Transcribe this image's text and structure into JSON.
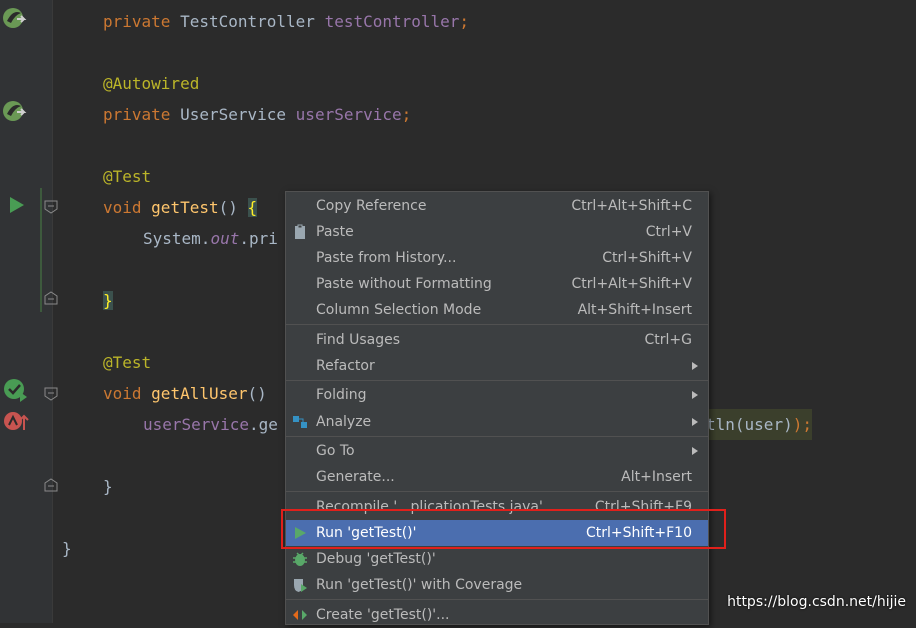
{
  "editor": {
    "line1": {
      "kw": "private",
      "type": " TestController ",
      "field": "testController",
      "end": ";"
    },
    "line3": {
      "ann": "@Autowired"
    },
    "line4": {
      "kw": "private",
      "type": " UserService ",
      "field": "userService",
      "end": ";"
    },
    "line6": {
      "ann": "@Test"
    },
    "line7": {
      "kw": "void",
      "name": "getTest",
      "paren": "() ",
      "brace": "{"
    },
    "line8": {
      "pre": "System.",
      "out": "out",
      "post": ".pri"
    },
    "line10": {
      "brace": "}"
    },
    "line12": {
      "ann": "@Test"
    },
    "line13": {
      "kw": "void",
      "name": "getAllUser",
      "paren": "()"
    },
    "line14": {
      "field": "userService",
      "post": ".ge",
      "tail_call": "tln",
      "tail_arg": "(user)",
      "tail_end": ");"
    },
    "line16": {
      "brace": "}"
    },
    "line18": {
      "brace": "}"
    }
  },
  "context_menu": {
    "items": [
      {
        "label": "Copy Reference",
        "shortcut": "Ctrl+Alt+Shift+C"
      },
      {
        "label": "Paste",
        "shortcut": "Ctrl+V"
      },
      {
        "label": "Paste from History...",
        "shortcut": "Ctrl+Shift+V"
      },
      {
        "label": "Paste without Formatting",
        "shortcut": "Ctrl+Alt+Shift+V"
      },
      {
        "label": "Column Selection Mode",
        "shortcut": "Alt+Shift+Insert"
      },
      {
        "label": "Find Usages",
        "shortcut": "Ctrl+G"
      },
      {
        "label": "Refactor",
        "shortcut": ""
      },
      {
        "label": "Folding",
        "shortcut": ""
      },
      {
        "label": "Analyze",
        "shortcut": ""
      },
      {
        "label": "Go To",
        "shortcut": ""
      },
      {
        "label": "Generate...",
        "shortcut": "Alt+Insert"
      },
      {
        "label": "Recompile '...plicationTests.java'",
        "shortcut": "Ctrl+Shift+F9"
      },
      {
        "label": "Run 'getTest()'",
        "shortcut": "Ctrl+Shift+F10"
      },
      {
        "label": "Debug 'getTest()'",
        "shortcut": ""
      },
      {
        "label": "Run 'getTest()' with Coverage",
        "shortcut": ""
      },
      {
        "label": "Create 'getTest()'...",
        "shortcut": ""
      }
    ],
    "selected_label": "Run 'getTest()'"
  },
  "watermark": "https://blog.csdn.net/hijie",
  "colors": {
    "background": "#2b2b2b",
    "keyword": "#cc7832",
    "annotation": "#bbb529",
    "field": "#9876aa",
    "method": "#ffc66d",
    "menu_bg": "#3c3f41",
    "menu_selected": "#4b6eaf",
    "highlight_box": "#e0201b",
    "run_icon": "#499c54"
  },
  "icons": [
    "spring-bean-icon",
    "run-test-icon",
    "run-test-passed-icon",
    "test-failed-icon",
    "paste-icon",
    "analyze-icon",
    "run-icon",
    "debug-icon",
    "coverage-icon",
    "create-icon",
    "submenu-arrow-icon"
  ]
}
